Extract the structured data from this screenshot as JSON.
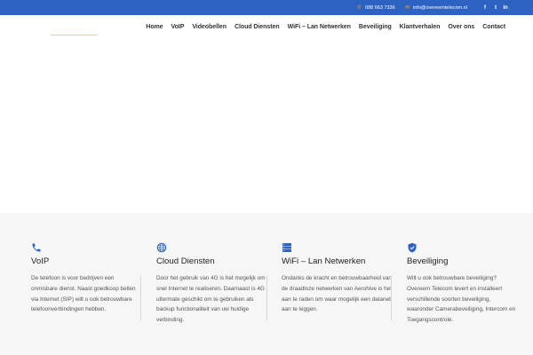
{
  "topbar": {
    "phone_icon": "phone-icon",
    "phone": "088 663 7336",
    "mail_icon": "mail-icon",
    "email": "info@overeemtelecom.nl",
    "social": [
      {
        "icon": "facebook-icon",
        "glyph": "f"
      },
      {
        "icon": "twitter-icon",
        "glyph": "t"
      },
      {
        "icon": "linkedin-icon",
        "glyph": "in"
      }
    ]
  },
  "nav": {
    "items": [
      "Home",
      "VoIP",
      "Videobellen",
      "Cloud Diensten",
      "WiFi – Lan Netwerken",
      "Beveiliging",
      "Klantverhalen",
      "Over ons",
      "Contact"
    ]
  },
  "colors": {
    "topbar": "#2c62c1",
    "accent_orange": "#f29a31",
    "icon_blue": "#2c62c1",
    "features_bg": "#f6f6f6"
  },
  "features": [
    {
      "icon": "phone-icon",
      "title": "VoIP",
      "text": "De telefoon is voor bedrijven een onmisbare dienst. Naast goedkoop bellen via Internet (SIP) wilt u ook betrouwbare telefoonverbindingen hebben."
    },
    {
      "icon": "globe-icon",
      "title": "Cloud Diensten",
      "text": "Door het gebruik van 4G is het mogelijk om snel Internet te realiseren. Daarnaast is 4G ultermate geschikt om te gebruiken als backup functionaliteit van uw huidige verbinding."
    },
    {
      "icon": "server-icon",
      "title": "WiFi – Lan Netwerken",
      "text": "Ondanks de kracht en betrouwbaarheid van de draadloze netwerken van Aerohive is het aan te raden om waar mogelijk een datanet aan te leggen."
    },
    {
      "icon": "shield-icon",
      "title": "Beveiliging",
      "text": "Wilt u ook betrouwbare beveiliging? Overeem Telecom levert en installeert verschillende soorten beveiliging, waaronder Camerabeveiliging, Intercom en Toegangscontrole."
    }
  ]
}
